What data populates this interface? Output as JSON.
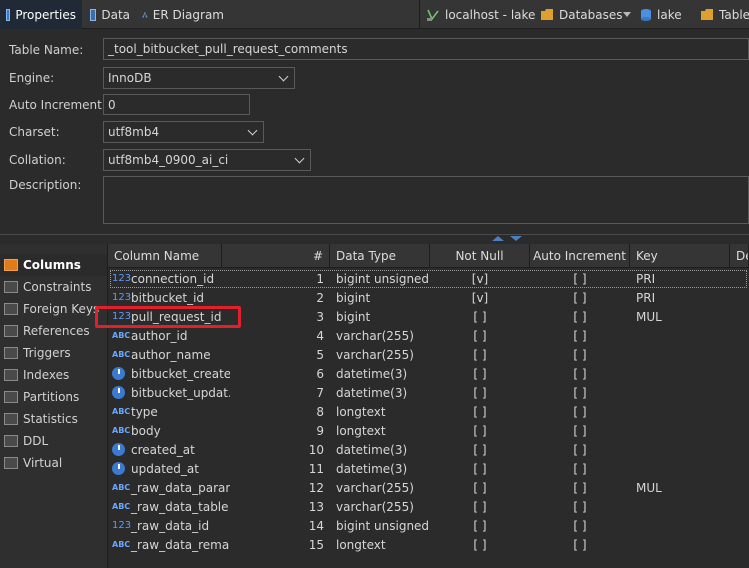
{
  "tabs": [
    {
      "label": "Properties",
      "icon": "properties-icon",
      "active": true
    },
    {
      "label": "Data",
      "icon": "data-grid-icon",
      "active": false
    },
    {
      "label": "ER Diagram",
      "icon": "er-diagram-icon",
      "active": false
    }
  ],
  "breadcrumb": {
    "connection": "localhost - lake",
    "databases": "Databases",
    "database": "lake",
    "tables": "Tables"
  },
  "form": {
    "table_name_label": "Table Name:",
    "table_name_value": "_tool_bitbucket_pull_request_comments",
    "engine_label": "Engine:",
    "engine_value": "InnoDB",
    "auto_increment_label": "Auto Increment:",
    "auto_increment_value": "0",
    "charset_label": "Charset:",
    "charset_value": "utf8mb4",
    "collation_label": "Collation:",
    "collation_value": "utf8mb4_0900_ai_ci",
    "description_label": "Description:",
    "description_value": ""
  },
  "sidenav": [
    {
      "label": "Columns",
      "active": true
    },
    {
      "label": "Constraints",
      "active": false
    },
    {
      "label": "Foreign Keys",
      "active": false
    },
    {
      "label": "References",
      "active": false
    },
    {
      "label": "Triggers",
      "active": false
    },
    {
      "label": "Indexes",
      "active": false
    },
    {
      "label": "Partitions",
      "active": false
    },
    {
      "label": "Statistics",
      "active": false
    },
    {
      "label": "DDL",
      "active": false
    },
    {
      "label": "Virtual",
      "active": false
    }
  ],
  "columns_header": [
    "Column Name",
    "#",
    "Data Type",
    "Not Null",
    "Auto Increment",
    "Key",
    "De"
  ],
  "rows": [
    {
      "name": "connection_id",
      "num": "1",
      "type": "bigint unsigned",
      "not_null": "[v]",
      "auto_inc": "[ ]",
      "key": "PRI",
      "icon": "num-key"
    },
    {
      "name": "bitbucket_id",
      "num": "2",
      "type": "bigint",
      "not_null": "[v]",
      "auto_inc": "[ ]",
      "key": "PRI",
      "icon": "num-key"
    },
    {
      "name": "pull_request_id",
      "num": "3",
      "type": "bigint",
      "not_null": "[ ]",
      "auto_inc": "[ ]",
      "key": "MUL",
      "icon": "num-key"
    },
    {
      "name": "author_id",
      "num": "4",
      "type": "varchar(255)",
      "not_null": "[ ]",
      "auto_inc": "[ ]",
      "key": "",
      "icon": "abc"
    },
    {
      "name": "author_name",
      "num": "5",
      "type": "varchar(255)",
      "not_null": "[ ]",
      "auto_inc": "[ ]",
      "key": "",
      "icon": "abc"
    },
    {
      "name": "bitbucket_create...",
      "num": "6",
      "type": "datetime(3)",
      "not_null": "[ ]",
      "auto_inc": "[ ]",
      "key": "",
      "icon": "clock"
    },
    {
      "name": "bitbucket_updat...",
      "num": "7",
      "type": "datetime(3)",
      "not_null": "[ ]",
      "auto_inc": "[ ]",
      "key": "",
      "icon": "clock"
    },
    {
      "name": "type",
      "num": "8",
      "type": "longtext",
      "not_null": "[ ]",
      "auto_inc": "[ ]",
      "key": "",
      "icon": "abc"
    },
    {
      "name": "body",
      "num": "9",
      "type": "longtext",
      "not_null": "[ ]",
      "auto_inc": "[ ]",
      "key": "",
      "icon": "abc"
    },
    {
      "name": "created_at",
      "num": "10",
      "type": "datetime(3)",
      "not_null": "[ ]",
      "auto_inc": "[ ]",
      "key": "",
      "icon": "clock"
    },
    {
      "name": "updated_at",
      "num": "11",
      "type": "datetime(3)",
      "not_null": "[ ]",
      "auto_inc": "[ ]",
      "key": "",
      "icon": "clock"
    },
    {
      "name": "_raw_data_params",
      "num": "12",
      "type": "varchar(255)",
      "not_null": "[ ]",
      "auto_inc": "[ ]",
      "key": "MUL",
      "icon": "abc-key"
    },
    {
      "name": "_raw_data_table",
      "num": "13",
      "type": "varchar(255)",
      "not_null": "[ ]",
      "auto_inc": "[ ]",
      "key": "",
      "icon": "abc"
    },
    {
      "name": "_raw_data_id",
      "num": "14",
      "type": "bigint unsigned",
      "not_null": "[ ]",
      "auto_inc": "[ ]",
      "key": "",
      "icon": "num"
    },
    {
      "name": "_raw_data_remark",
      "num": "15",
      "type": "longtext",
      "not_null": "[ ]",
      "auto_inc": "[ ]",
      "key": "",
      "icon": "abc"
    }
  ],
  "colors": {
    "accent": "#3c79c8",
    "highlight_box": "#e0202a",
    "active_nav_icon": "#e07b1a"
  }
}
